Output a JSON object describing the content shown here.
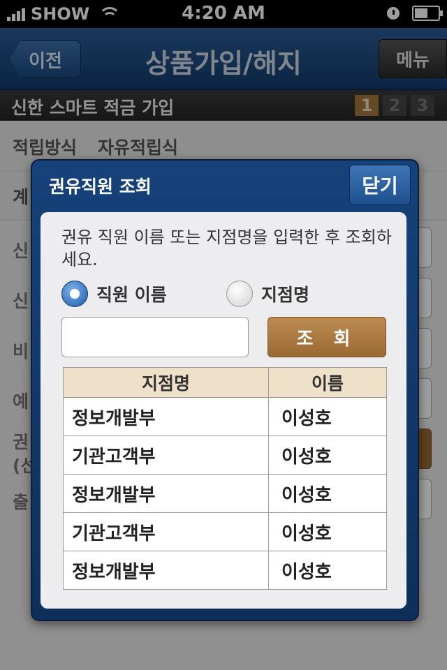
{
  "status": {
    "carrier": "SHOW",
    "time": "4:20 AM"
  },
  "nav": {
    "back": "이전",
    "title": "상품가입/해지",
    "menu": "메뉴"
  },
  "subheader": {
    "title": "신한 스마트 적금 가입",
    "steps": [
      "1",
      "2",
      "3"
    ],
    "active_step": 1
  },
  "background": {
    "row1": {
      "label": "적립방식",
      "value": "자유적립식"
    },
    "row2": {
      "label": "계"
    },
    "labels": [
      "신",
      "신",
      "비",
      "예",
      "권",
      "(선",
      "출"
    ]
  },
  "modal": {
    "title": "권유직원 조회",
    "close": "닫기",
    "description": "권유 직원 이름 또는 지점명을 입력한 후 조회하세요.",
    "radio_name": "직원 이름",
    "radio_branch": "지점명",
    "name_input_value": "",
    "search": "조 회",
    "table": {
      "headers": [
        "지점명",
        "이름"
      ],
      "rows": [
        [
          "정보개발부",
          "이성호"
        ],
        [
          "기관고객부",
          "이성호"
        ],
        [
          "정보개발부",
          "이성호"
        ],
        [
          "기관고객부",
          "이성호"
        ],
        [
          "정보개발부",
          "이성호"
        ]
      ]
    }
  }
}
